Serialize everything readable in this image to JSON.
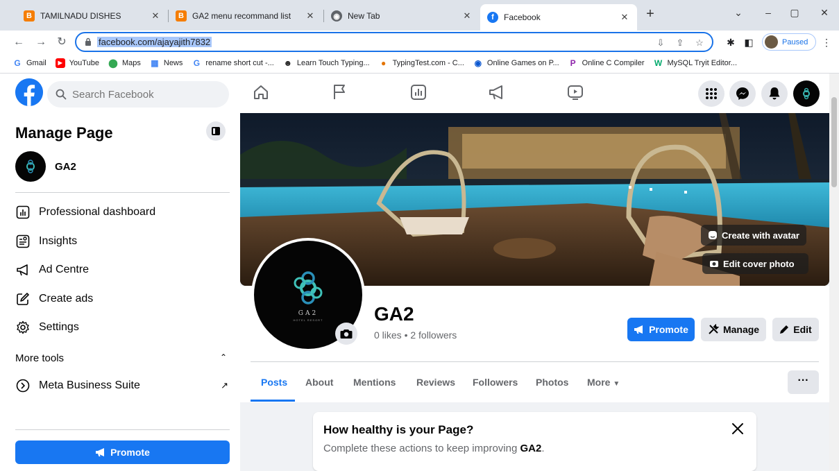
{
  "browser": {
    "tabs": [
      {
        "title": "TAMILNADU DISHES",
        "favicon": "blogger-icon",
        "active": false
      },
      {
        "title": "GA2 menu recommand list",
        "favicon": "blogger-icon",
        "active": false
      },
      {
        "title": "New Tab",
        "favicon": "chrome-icon",
        "active": false
      },
      {
        "title": "Facebook",
        "favicon": "facebook-icon",
        "active": true
      }
    ],
    "url": "facebook.com/ajayajith7832",
    "profile_status": "Paused",
    "bookmarks": [
      {
        "label": "Gmail",
        "icon": "google-icon"
      },
      {
        "label": "YouTube",
        "icon": "youtube-icon"
      },
      {
        "label": "Maps",
        "icon": "maps-icon"
      },
      {
        "label": "News",
        "icon": "news-icon"
      },
      {
        "label": "rename short cut -...",
        "icon": "google-icon"
      },
      {
        "label": "Learn Touch Typing...",
        "icon": "typing-icon"
      },
      {
        "label": "TypingTest.com - C...",
        "icon": "typingtest-icon"
      },
      {
        "label": "Online Games on P...",
        "icon": "games-icon"
      },
      {
        "label": "Online C Compiler",
        "icon": "compiler-icon"
      },
      {
        "label": "MySQL Tryit Editor...",
        "icon": "w3schools-icon"
      }
    ]
  },
  "facebook": {
    "search_placeholder": "Search Facebook",
    "colors": {
      "brand": "#1877f2",
      "text": "#050505",
      "muted": "#65676b"
    }
  },
  "sidebar": {
    "title": "Manage Page",
    "page_name": "GA2",
    "items": [
      {
        "label": "Professional dashboard",
        "icon": "dashboard-icon"
      },
      {
        "label": "Insights",
        "icon": "insights-icon"
      },
      {
        "label": "Ad Centre",
        "icon": "megaphone-icon"
      },
      {
        "label": "Create ads",
        "icon": "edit-icon"
      },
      {
        "label": "Settings",
        "icon": "gear-icon"
      }
    ],
    "more_tools_label": "More tools",
    "meta_business_label": "Meta Business Suite",
    "promote_label": "Promote"
  },
  "cover": {
    "create_avatar_label": "Create with avatar",
    "edit_cover_label": "Edit cover photo"
  },
  "profile": {
    "name": "GA2",
    "stats": "0 likes • 2 followers",
    "logo_text": "GA2",
    "logo_subtext": "HOTEL RESORT",
    "promote_label": "Promote",
    "manage_label": "Manage",
    "edit_label": "Edit",
    "tabs": [
      "Posts",
      "About",
      "Mentions",
      "Reviews",
      "Followers",
      "Photos",
      "More"
    ],
    "more_btn": "···"
  },
  "health": {
    "title": "How healthy is your Page?",
    "subtitle_pre": "Complete these actions to keep improving ",
    "subtitle_page": "GA2",
    "subtitle_post": "."
  }
}
